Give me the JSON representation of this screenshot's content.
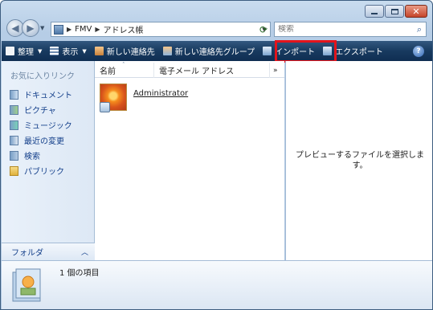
{
  "window": {
    "address": {
      "crumbs": [
        "FMV",
        "アドレス帳"
      ]
    },
    "search": {
      "placeholder": "検索"
    }
  },
  "toolbar": {
    "organize": "整理",
    "view": "表示",
    "new_contact": "新しい連絡先",
    "new_group": "新しい連絡先グループ",
    "import": "インポート",
    "export": "エクスポート"
  },
  "nav_pane": {
    "heading": "お気に入りリンク",
    "items": [
      {
        "label": "ドキュメント",
        "icon": "documents-icon"
      },
      {
        "label": "ピクチャ",
        "icon": "pictures-icon"
      },
      {
        "label": "ミュージック",
        "icon": "music-icon"
      },
      {
        "label": "最近の変更",
        "icon": "recent-changes-icon"
      },
      {
        "label": "検索",
        "icon": "searches-icon"
      },
      {
        "label": "パブリック",
        "icon": "public-folder-icon"
      }
    ],
    "folders_label": "フォルダ"
  },
  "content": {
    "columns": {
      "name": "名前",
      "email": "電子メール アドレス",
      "more": "»"
    },
    "contacts": [
      {
        "name": "Administrator",
        "email": ""
      }
    ]
  },
  "preview": {
    "message": "プレビューするファイルを選択します。"
  },
  "details": {
    "item_count": "1 個の項目"
  },
  "colors": {
    "toolbar_bg": "#183a5f",
    "highlight_border": "#e3141c",
    "link_blue": "#133f8a"
  }
}
